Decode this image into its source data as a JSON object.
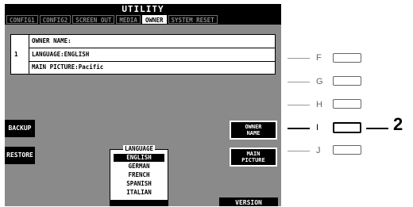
{
  "screen": {
    "title": "UTILITY",
    "tabs": [
      {
        "label": "CONFIG1",
        "active": false
      },
      {
        "label": "CONFIG2",
        "active": false
      },
      {
        "label": "SCREEN OUT",
        "active": false
      },
      {
        "label": "MEDIA",
        "active": false
      },
      {
        "label": "OWNER",
        "active": true
      },
      {
        "label": "SYSTEM RESET",
        "active": false
      }
    ],
    "info": {
      "index": "1",
      "rows": [
        "OWNER NAME:",
        "LANGUAGE:ENGLISH",
        "MAIN PICTURE:Pacific"
      ]
    },
    "left_buttons": {
      "backup": "BACKUP",
      "restore": "RESTORE"
    },
    "language_list": {
      "title": "LANGUAGE",
      "items": [
        "ENGLISH",
        "GERMAN",
        "FRENCH",
        "SPANISH",
        "ITALIAN"
      ],
      "selected": "ENGLISH"
    },
    "right_buttons": {
      "owner_name": [
        "OWNER",
        "NAME"
      ],
      "main_picture": [
        "MAIN",
        "PICTURE"
      ],
      "version": "VERSION"
    }
  },
  "panel": {
    "letters": [
      "F",
      "G",
      "H",
      "I",
      "J"
    ],
    "active_letter": "I",
    "callout": "2"
  }
}
